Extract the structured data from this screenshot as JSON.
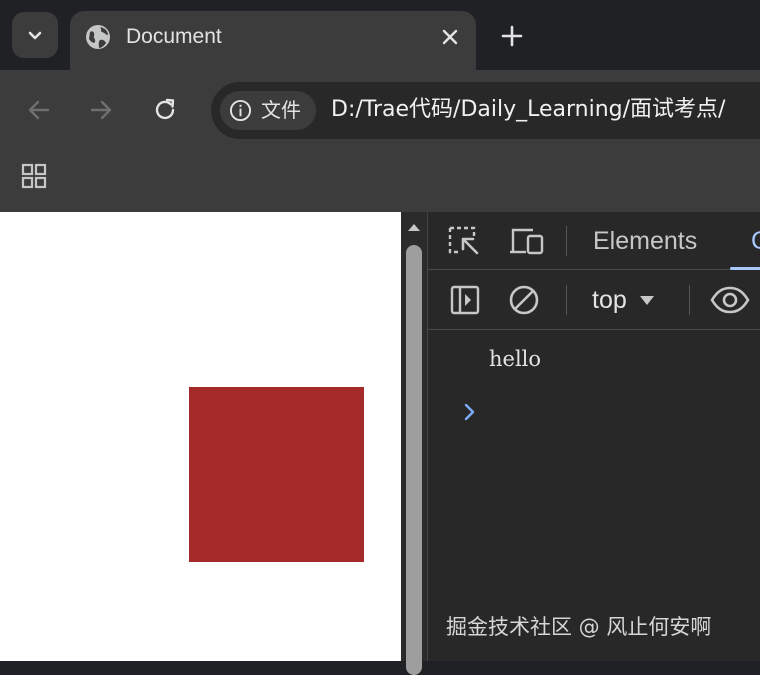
{
  "browser": {
    "tab": {
      "title": "Document",
      "favicon": "globe-icon"
    },
    "tab_search_icon": "chevron-down-icon",
    "new_tab_icon": "plus-icon",
    "toolbar": {
      "back_icon": "arrow-left-icon",
      "forward_icon": "arrow-right-icon",
      "reload_icon": "reload-icon",
      "site_info": {
        "icon": "info-icon",
        "label": "文件"
      },
      "url": "D:/Trae代码/Daily_Learning/面试考点/"
    },
    "bookmarks_bar": {
      "apps_icon": "apps-grid-icon"
    }
  },
  "page": {
    "box_color": "#a52a2a",
    "background": "#ffffff"
  },
  "devtools": {
    "tabs": {
      "inspect_icon": "inspect-element-icon",
      "device_icon": "device-toolbar-icon",
      "elements_label": "Elements",
      "console_label": "C",
      "active_color": "#a8c7fa"
    },
    "console_toolbar": {
      "sidebar_icon": "sidebar-toggle-icon",
      "clear_icon": "clear-console-icon",
      "context": "top",
      "eye_icon": "eye-icon"
    },
    "console": {
      "messages": [
        "hello"
      ],
      "prompt_icon": "prompt-chevron-icon"
    }
  },
  "watermark": "掘金技术社区 @ 风止何安啊"
}
